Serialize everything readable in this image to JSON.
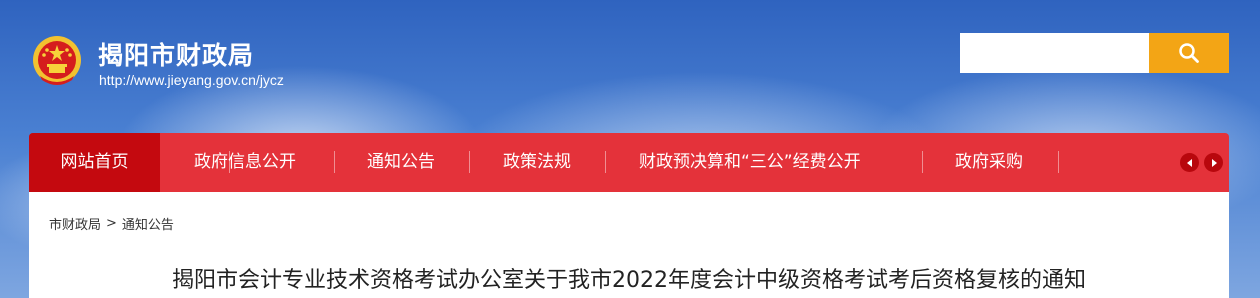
{
  "header": {
    "site_title": "揭阳市财政局",
    "site_url": "http://www.jieyang.gov.cn/jycz",
    "emblem_icon": "national-emblem-icon"
  },
  "search": {
    "placeholder": "",
    "value": "",
    "icon": "search-icon"
  },
  "nav": {
    "items": [
      {
        "label": "网站首页",
        "active": true
      },
      {
        "label": "政府信息公开",
        "active": false
      },
      {
        "label": "通知公告",
        "active": false
      },
      {
        "label": "政策法规",
        "active": false
      },
      {
        "label": "财政预决算和“三公”经费公开",
        "active": false
      },
      {
        "label": "政府采购",
        "active": false
      }
    ],
    "prev_icon": "chevron-left-icon",
    "next_icon": "chevron-right-icon"
  },
  "breadcrumb": {
    "items": [
      "市财政局",
      "通知公告"
    ],
    "separator": ">"
  },
  "article": {
    "title": "揭阳市会计专业技术资格考试办公室关于我市2022年度会计中级资格考试考后资格复核的通知"
  },
  "colors": {
    "nav_bg": "#e4323a",
    "nav_active_bg": "#c4090f",
    "search_button": "#f3a515",
    "header_bg": "#3f74c9"
  }
}
